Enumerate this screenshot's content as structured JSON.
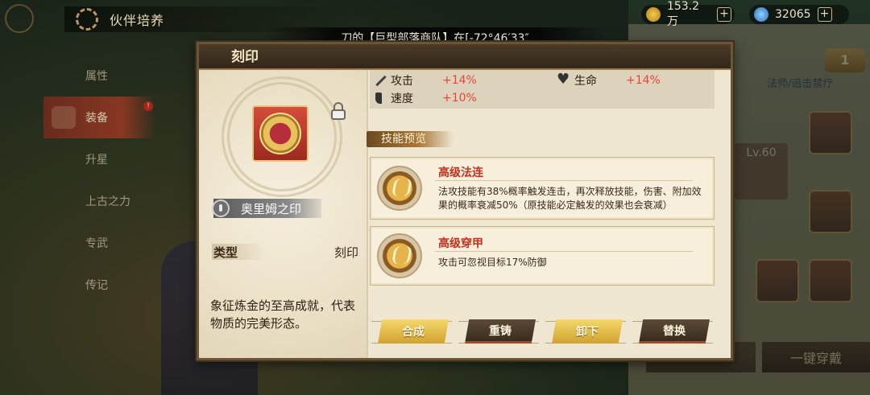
{
  "header": {
    "title": "伙伴培养"
  },
  "resources": {
    "gold": {
      "value": "153.2万",
      "plus": "+"
    },
    "gem": {
      "value": "32065",
      "plus": "+"
    }
  },
  "sidebar": {
    "items": [
      {
        "label": "属性"
      },
      {
        "label": "装备",
        "badge": "!"
      },
      {
        "label": "升星"
      },
      {
        "label": "上古之力"
      },
      {
        "label": "专武"
      },
      {
        "label": "传记"
      }
    ]
  },
  "ticker": {
    "text": "刀的【巨型部落商队】在[-72°46′33″"
  },
  "right_panel": {
    "rank": "1",
    "class_tag": "法师/追击禁疗",
    "level": "Lv.60",
    "one_click_label": "一键穿戴"
  },
  "dialog": {
    "title": "刻印",
    "item": {
      "name": "奥里姆之印",
      "type_label": "类型",
      "type_value": "刻印",
      "description": "象征炼金的至高成就，代表物质的完美形态。"
    },
    "stats": [
      {
        "name": "攻击",
        "value": "+14%",
        "icon": "sword-icon"
      },
      {
        "name": "生命",
        "value": "+14%",
        "icon": "heart-icon"
      },
      {
        "name": "速度",
        "value": "+10%",
        "icon": "boot-icon"
      }
    ],
    "skill_preview_label": "技能预览",
    "skills": [
      {
        "name": "高级法连",
        "desc": "法攻技能有38%概率触发连击，再次释放技能，伤害、附加效果的概率衰减50%（原技能必定触发的效果也会衰减）"
      },
      {
        "name": "高级穿甲",
        "desc": "攻击可忽视目标17%防御"
      }
    ],
    "buttons": {
      "compose": "合成",
      "recast": "重铸",
      "unequip": "卸下",
      "replace": "替换"
    }
  },
  "colors": {
    "stat_value": "#e6473a",
    "skill_name": "#c1321f",
    "header_bg": "#3b2f1e",
    "gold_button": "#d1a230"
  }
}
